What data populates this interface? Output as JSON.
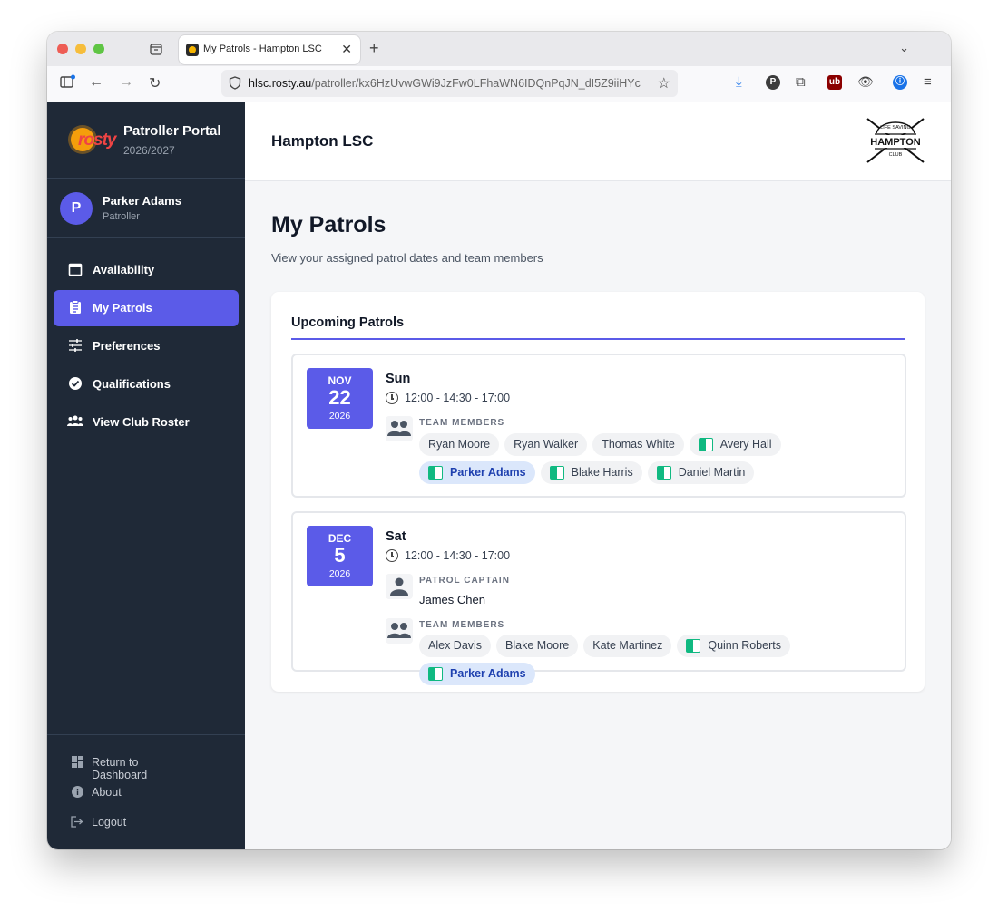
{
  "browser": {
    "tab_title": "My Patrols - Hampton LSC",
    "url_domain": "hlsc.rosty.au",
    "url_path": "/patroller/kx6HzUvwGWi9JzFw0LFhaWN6IDQnPqJN_dI5Z9iiHYc"
  },
  "sidebar": {
    "logo_text": "rosty",
    "portal_title": "Patroller Portal",
    "season": "2026/2027",
    "user": {
      "initial": "P",
      "name": "Parker Adams",
      "role": "Patroller"
    },
    "menu": [
      {
        "label": "Availability",
        "icon": "calendar-icon"
      },
      {
        "label": "My Patrols",
        "icon": "clipboard-icon",
        "active": true
      },
      {
        "label": "Preferences",
        "icon": "sliders-icon"
      },
      {
        "label": "Qualifications",
        "icon": "verified-badge-icon"
      },
      {
        "label": "View Club Roster",
        "icon": "group-icon"
      }
    ],
    "footer": [
      {
        "label": "Return to Dashboard",
        "icon": "dashboard-icon"
      },
      {
        "label": "About",
        "icon": "info-icon"
      },
      {
        "label": "Logout",
        "icon": "logout-icon"
      }
    ]
  },
  "header": {
    "club_name": "Hampton LSC",
    "club_logo_text": {
      "top": "LIFE SAVING",
      "main": "HAMPTON",
      "bottom": "CLUB"
    }
  },
  "main": {
    "title": "My Patrols",
    "subtitle": "View your assigned patrol dates and team members",
    "section_title": "Upcoming Patrols",
    "patrols": [
      {
        "month": "NOV",
        "day": "22",
        "year": "2026",
        "weekday": "Sun",
        "time": "12:00 - 14:30 - 17:00",
        "team_label": "TEAM MEMBERS",
        "members": [
          {
            "name": "Ryan Moore",
            "flag": false,
            "me": false
          },
          {
            "name": "Ryan Walker",
            "flag": false,
            "me": false
          },
          {
            "name": "Thomas White",
            "flag": false,
            "me": false
          },
          {
            "name": "Avery Hall",
            "flag": true,
            "me": false
          },
          {
            "name": "Parker Adams",
            "flag": true,
            "me": true
          },
          {
            "name": "Blake Harris",
            "flag": true,
            "me": false
          },
          {
            "name": "Daniel Martin",
            "flag": true,
            "me": false
          }
        ]
      },
      {
        "month": "DEC",
        "day": "5",
        "year": "2026",
        "weekday": "Sat",
        "time": "12:00 - 14:30 - 17:00",
        "captain_label": "PATROL CAPTAIN",
        "captain": "James Chen",
        "team_label": "TEAM MEMBERS",
        "members": [
          {
            "name": "Alex Davis",
            "flag": false,
            "me": false
          },
          {
            "name": "Blake Moore",
            "flag": false,
            "me": false
          },
          {
            "name": "Kate Martinez",
            "flag": false,
            "me": false
          },
          {
            "name": "Quinn Roberts",
            "flag": true,
            "me": false
          },
          {
            "name": "Parker Adams",
            "flag": true,
            "me": true
          }
        ]
      }
    ]
  },
  "colors": {
    "accent": "#5b5be8",
    "sidebar_bg": "#1f2937",
    "flag": "#10b981",
    "me_chip": "#dbe7fb"
  }
}
